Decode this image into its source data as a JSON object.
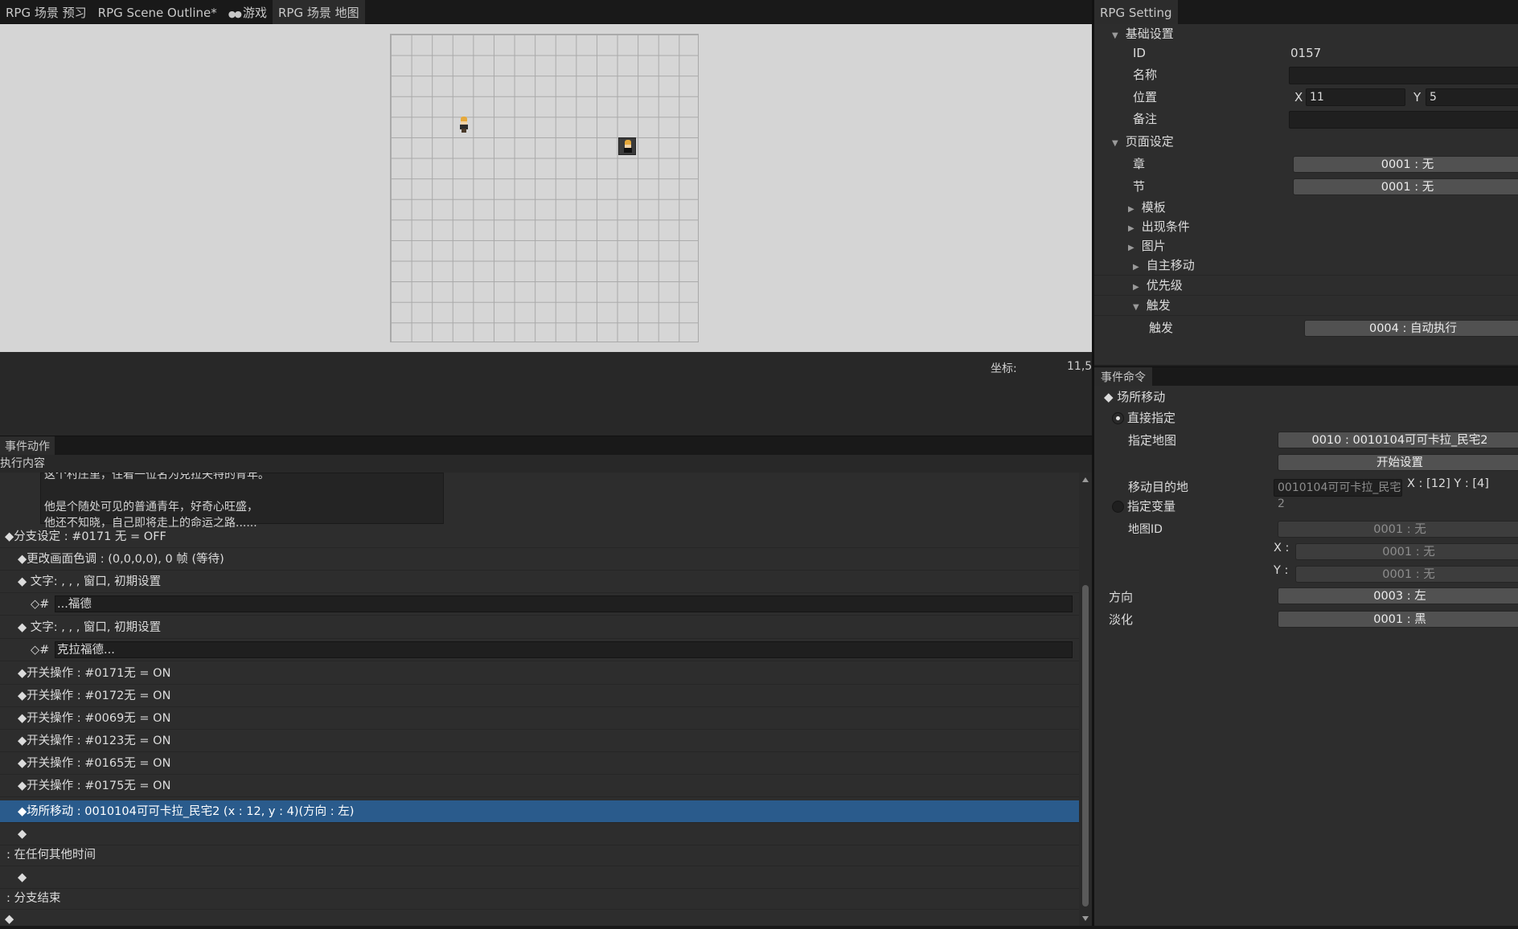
{
  "scene_tabs": [
    "RPG 场景 预习",
    "RPG Scene Outline*",
    "游戏",
    "RPG 场景 地图"
  ],
  "game_tab_icon": "gamepad-icon",
  "coord": {
    "label": "坐标:",
    "value": "11,5"
  },
  "action_panel": {
    "tab": "事件动作",
    "sub_label": "执行内容",
    "message_lines": [
      "这个村庄里，住着一位名为克拉夫特的青年。",
      "",
      "他是个随处可见的普通青年，好奇心旺盛，",
      "他还不知晓，自己即将走上的命运之路......"
    ],
    "rows": [
      "◆分支设定 : #0171 无 = OFF",
      "◆更改画面色调 : (0,0,0,0), 0 帧 (等待)",
      "◆ 文字: , , , 窗口, 初期设置",
      "◇#",
      "◆ 文字: , , , 窗口, 初期设置",
      "◇#",
      "◆开关操作 : #0171无 = ON",
      "◆开关操作 : #0172无 = ON",
      "◆开关操作 : #0069无 = ON",
      "◆开关操作 : #0123无 = ON",
      "◆开关操作 : #0165无 = ON",
      "◆开关操作 : #0175无 = ON",
      "◆场所移动 : 0010104可可卡拉_民宅2 (x : 12, y : 4)(方向 : 左)",
      "◆",
      ": 在任何其他时间",
      "◆",
      ": 分支结束",
      "◆"
    ],
    "text_fields": [
      "...福德",
      "克拉福德..."
    ]
  },
  "setting": {
    "tab": "RPG Setting",
    "basic_section": "基础设置",
    "id_label": "ID",
    "id_value": "0157",
    "name_label": "名称",
    "name_value": "",
    "pos_label": "位置",
    "x_label": "X",
    "x_value": "11",
    "y_label": "Y",
    "y_value": "5",
    "note_label": "备注",
    "note_value": "",
    "page_section": "页面设定",
    "chapter_label": "章",
    "chapter_value": "0001 : 无",
    "section_label": "节",
    "section_value": "0001 : 无",
    "template_label": "模板",
    "condition_label": "出现条件",
    "image_label": "图片",
    "automove_label": "自主移动",
    "priority_label": "优先级",
    "trigger_section": "触发",
    "trigger_label": "触发",
    "trigger_value": "0004 : 自动执行"
  },
  "command": {
    "tab": "事件命令",
    "title": "◆ 场所移动",
    "direct_label": "直接指定",
    "map_label": "指定地图",
    "map_value": "0010 : 0010104可可卡拉_民宅2",
    "start_button": "开始设置",
    "dest_label": "移动目的地",
    "dest_value": "0010104可可卡拉_民宅2",
    "dest_coords": "X : [12] Y : [4]",
    "var_label": "指定变量",
    "mapid_label": "地图ID",
    "mapid_value": "0001 : 无",
    "x_label": "X :",
    "x_value": "0001 : 无",
    "y_label": "Y :",
    "y_value": "0001 : 无",
    "dir_label": "方向",
    "dir_value": "0003 : 左",
    "fade_label": "淡化",
    "fade_value": "0001 : 黑"
  }
}
